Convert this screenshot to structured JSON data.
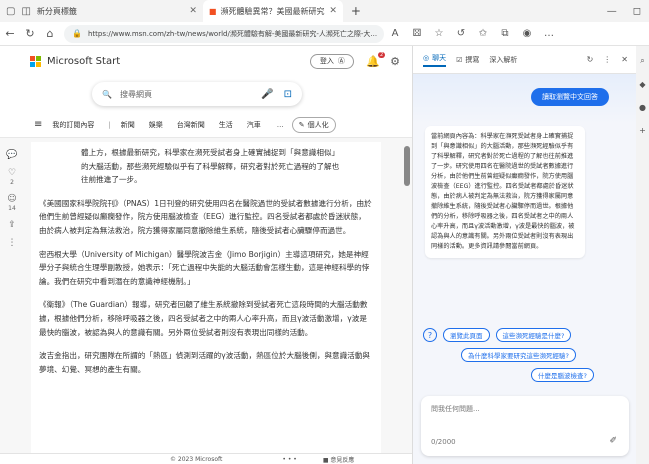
{
  "browser": {
    "tabs": [
      {
        "label": "新分頁標籤"
      },
      {
        "label": "瀕死體驗異常？美國最新研究"
      }
    ],
    "url": "https://www.msn.com/zh-tw/news/world/瀕死體驗有解-美國最新研究-人瀕死亡之際-大..."
  },
  "header": {
    "brand": "Microsoft Start",
    "signin": "登入",
    "notifications": "2"
  },
  "search": {
    "placeholder": "搜尋網頁"
  },
  "nav": {
    "items": [
      "我的訂閱內容",
      "新聞",
      "娛樂",
      "台灣新聞",
      "生活",
      "汽車"
    ],
    "personalize": "個人化"
  },
  "rail": {
    "count1": "2",
    "count2": "14"
  },
  "article": {
    "quote": "體上方，根據最新研究，科學家在瀕死受試者身上確實捕捉到「與意識相似」的大腦活動，那些瀕死經驗似乎有了科學解釋，研究者對於死亡過程的了解也往前推進了一步。",
    "p1": "《美國國家科學院院刊》（PNAS）1日刊登的研究使用四名在醫院過世的受試者數據進行分析，由於他們生前曾經疑似癲癇發作，院方使用腦波檢查（EEG）進行監控。四名受試者都處於昏迷狀態，由於病人被判定為無法救治，院方獲得家屬同意撤除維生系統，隨後受試者心臟驟停而過世。",
    "p2": "密西根大學（University of Michigan）醫學院波吉金（Jimo Borjigin）主導這項研究，她是神經學分子與統合生理學副教授，她表示：「死亡過程中失能的大腦活動會怎樣生動，這是神經科學的悖論。我們在研究中看到潛在的意識神經機制。」",
    "p3": "《衛報》（The Guardian）報導，研究者回顧了維生系統撤除到受試者死亡這段時間的大腦活動數據，根據他們分析，移除呼吸器之後，四名受試者之中的兩人心率升高，而且γ波活動激增，γ波是最快的腦波，被認為與人的意識有關。另外兩位受試者則沒有表現出同樣的活動。",
    "p4": "波吉金指出，研究團隊在所謂的「熱區」偵測到活躍的γ波活動，熱區位於大腦後側，與意識活動與夢境、幻覺、冥想的產生有關。"
  },
  "footer": {
    "copyright": "© 2023 Microsoft",
    "dots": "• • •",
    "feedback": "意見反應"
  },
  "chat": {
    "tabs": [
      "聊天",
      "撰寫",
      "深入解析"
    ],
    "primary_button": "讀取瀏覽中文回答",
    "summary": "當前網頁內容為：科學家在瀕死受試者身上確實捕捉到「與意識相似」的大腦活動，那些瀕死經驗似乎有了科學解釋，研究者對於死亡過程的了解也往前推進了一步。研究使用四名在醫院過世的受試者數據進行分析，由於他們生前曾經疑似癲癇發作，院方使用腦波檢查（EEG）進行監控。四名受試者都處於昏迷狀態，由於病人被判定為無法救治，院方獲得家屬同意撤除維生系統，隨後受試者心臟驟停而過世。根據他們的分析，移除呼吸器之後，四名受試者之中的兩人心率升高，而且γ波活動激增，γ波是最快的腦波，被認為與人的意識有關。另外兩位受試者則沒有表現出同樣的活動。更多資訊請參閱當前網頁。",
    "suggestions": [
      "瀏覽此頁面",
      "這些瀕死經驗是什麼?",
      "為什麼科學家要研究這些瀕死經驗?",
      "什麼是腦波檢查?"
    ],
    "input_placeholder": "問我任何問題...",
    "char_count": "0/2000"
  },
  "colors": {
    "accent": "#1f6feb",
    "ms_red": "#f25022",
    "ms_green": "#7fba00",
    "ms_blue": "#00a4ef",
    "ms_yellow": "#ffb900"
  }
}
